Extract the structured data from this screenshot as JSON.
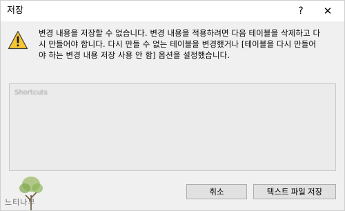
{
  "window": {
    "title": "저장",
    "help_glyph": "?",
    "close_glyph": "✕"
  },
  "message": {
    "icon": "warning-icon",
    "lines": [
      "변경 내용을 저장할 수 없습니다. 변경 내용을 적용하려면 다음 테이블을 삭제하고 다",
      "시 만들어야 합니다. 다시 만들 수 없는 테이블을 변경했거나 [테이블을 다시 만들어",
      "야 하는 변경 내용 저장 사용 안 함] 옵션을 설정했습니다."
    ]
  },
  "details": {
    "text": "Shortcuts"
  },
  "buttons": {
    "cancel_label": "취소",
    "save_text_file_label": "텍스트 파일 저장"
  },
  "watermark": {
    "text": "느티나무"
  },
  "colors": {
    "warning_fill": "#f6c531",
    "warning_stroke": "#3a3a3a",
    "titlebar": "#ffffff",
    "dialog_bg": "#f0f0f0",
    "button_bg": "#e1e1e1"
  }
}
